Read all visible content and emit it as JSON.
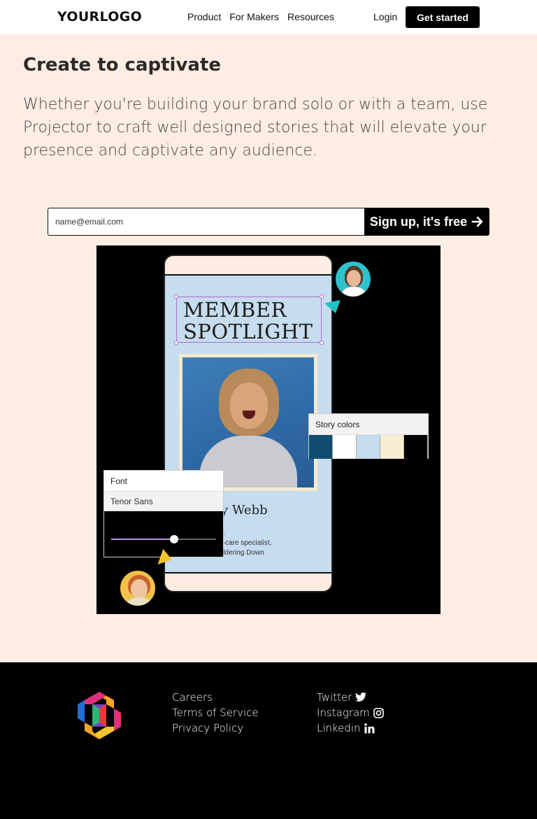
{
  "header": {
    "logo": "YOURLOGO",
    "nav": [
      "Product",
      "For Makers",
      "Resources"
    ],
    "login": "Login",
    "cta": "Get started"
  },
  "hero": {
    "title": "Create to captivate",
    "text": "Whether you're building your brand solo or with a team, use Projector to craft well designed stories that will elevate your presence and captivate any audience.",
    "email_placeholder": "name@email.com",
    "signup_button": "Sign up, it's free"
  },
  "illustration": {
    "title_line1": "MEMBER",
    "title_line2": "SPOTLIGHT",
    "name_partial": "y Webb",
    "bio_line1": "s",
    "bio_line2": "f-care specialist,",
    "bio_line3": "ddering Down",
    "story_colors_label": "Story colors",
    "swatches": [
      "#0f4c6e",
      "#ffffff",
      "#c6dcef",
      "#f8ecd1",
      "#000000"
    ],
    "font_label": "Font",
    "font_name": "Tenor Sans",
    "font_size_slider": 0.6
  },
  "footer": {
    "links": [
      "Careers",
      "Terms of Service",
      "Privacy Policy"
    ],
    "social": [
      {
        "label": "Twitter",
        "icon": "twitter-icon"
      },
      {
        "label": "Instagram",
        "icon": "instagram-icon"
      },
      {
        "label": "Linkedin",
        "icon": "linkedin-icon"
      }
    ]
  }
}
